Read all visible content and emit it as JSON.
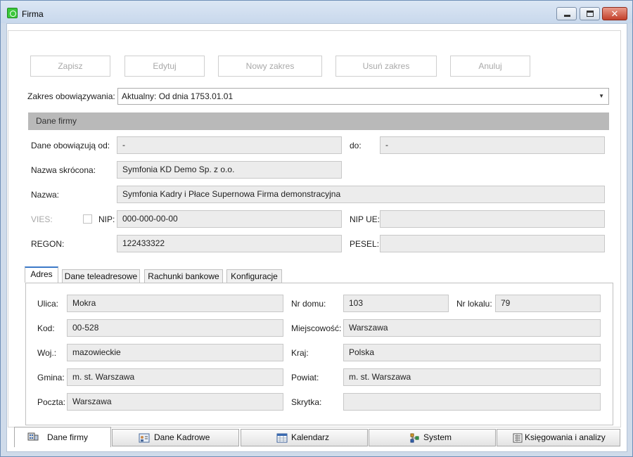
{
  "window": {
    "title": "Firma",
    "close_glyph": "✕"
  },
  "toolbar": {
    "save": "Zapisz",
    "edit": "Edytuj",
    "new_range": "Nowy zakres",
    "delete_range": "Usuń zakres",
    "cancel": "Anuluj"
  },
  "scope": {
    "label": "Zakres obowiązywania:",
    "value": "Aktualny: Od dnia 1753.01.01"
  },
  "company": {
    "header": "Dane firmy",
    "valid_from_label": "Dane obowiązują od:",
    "valid_from": "-",
    "valid_to_label": "do:",
    "valid_to": "-",
    "short_name_label": "Nazwa skrócona:",
    "short_name": "Symfonia KD Demo Sp. z o.o.",
    "name_label": "Nazwa:",
    "name": "Symfonia Kadry i Płace Supernowa Firma demonstracyjna",
    "vies_label": "VIES:",
    "vies_checked": false,
    "nip_label": "NIP:",
    "nip": "000-000-00-00",
    "nip_ue_label": "NIP UE:",
    "nip_ue": "",
    "regon_label": "REGON:",
    "regon": "122433322",
    "pesel_label": "PESEL:",
    "pesel": ""
  },
  "tabs": [
    {
      "label": "Adres",
      "active": true
    },
    {
      "label": "Dane teleadresowe",
      "active": false
    },
    {
      "label": "Rachunki bankowe",
      "active": false
    },
    {
      "label": "Konfiguracje",
      "active": false
    }
  ],
  "address": {
    "street_label": "Ulica:",
    "street": "Mokra",
    "house_label": "Nr domu:",
    "house": "103",
    "flat_label": "Nr lokalu:",
    "flat": "79",
    "postcode_label": "Kod:",
    "postcode": "00-528",
    "city_label": "Miejscowość:",
    "city": "Warszawa",
    "voivodeship_label": "Woj.:",
    "voivodeship": "mazowieckie",
    "country_label": "Kraj:",
    "country": "Polska",
    "commune_label": "Gmina:",
    "commune": "m. st. Warszawa",
    "county_label": "Powiat:",
    "county": "m. st. Warszawa",
    "post_label": "Poczta:",
    "post": "Warszawa",
    "pobox_label": "Skrytka:",
    "pobox": ""
  },
  "bottom_tabs": [
    {
      "label": "Dane firmy",
      "icon": "company-icon",
      "active": true
    },
    {
      "label": "Dane Kadrowe",
      "icon": "hr-icon",
      "active": false
    },
    {
      "label": "Kalendarz",
      "icon": "calendar-icon",
      "active": false
    },
    {
      "label": "System",
      "icon": "system-icon",
      "active": false
    },
    {
      "label": "Księgowania i analizy",
      "icon": "accounting-icon",
      "active": false
    }
  ]
}
